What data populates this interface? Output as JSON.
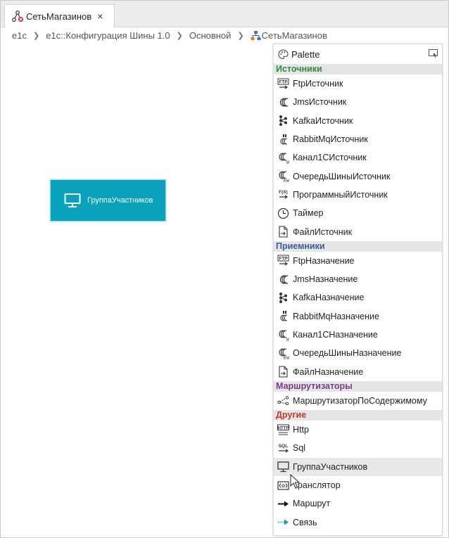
{
  "tab": {
    "label": "СетьМагазинов",
    "close_label": "×"
  },
  "breadcrumb": {
    "items": [
      "e1c",
      "e1c::Конфигурация Шины 1.0",
      "Основной",
      "СетьМагазинов"
    ]
  },
  "canvas": {
    "node": {
      "label": "ГруппаУчастников",
      "color": "#0aa2bd"
    }
  },
  "palette": {
    "title": "Palette",
    "sections": [
      {
        "title": "Источники",
        "color": "#2e8b3a",
        "items": [
          {
            "label": "FtpИсточник",
            "icon": "ftp-icon"
          },
          {
            "label": "JmsИсточник",
            "icon": "jms-icon"
          },
          {
            "label": "KafkaИсточник",
            "icon": "kafka-icon"
          },
          {
            "label": "RabbitMqИсточник",
            "icon": "rabbitmq-icon"
          },
          {
            "label": "Канал1СИсточник",
            "icon": "channel-1c-icon"
          },
          {
            "label": "ОчередьШиныИсточник",
            "icon": "esb-queue-icon"
          },
          {
            "label": "ПрограммныйИсточник",
            "icon": "function-icon"
          },
          {
            "label": "Таймер",
            "icon": "clock-icon"
          },
          {
            "label": "ФайлИсточник",
            "icon": "file-icon"
          }
        ]
      },
      {
        "title": "Приемники",
        "color": "#3c5a99",
        "items": [
          {
            "label": "FtpНазначение",
            "icon": "ftp-icon"
          },
          {
            "label": "JmsНазначение",
            "icon": "jms-icon"
          },
          {
            "label": "KafkaНазначение",
            "icon": "kafka-icon"
          },
          {
            "label": "RabbitMqНазначение",
            "icon": "rabbitmq-icon"
          },
          {
            "label": "Канал1СНазначение",
            "icon": "channel-1c-icon"
          },
          {
            "label": "ОчередьШиныНазначение",
            "icon": "esb-queue-icon"
          },
          {
            "label": "ФайлНазначение",
            "icon": "file-icon"
          }
        ]
      },
      {
        "title": "Маршрутизаторы",
        "color": "#7a3c8a",
        "items": [
          {
            "label": "МаршрутизаторПоСодержимому",
            "icon": "router-icon"
          }
        ]
      },
      {
        "title": "Другие",
        "color": "#c0392b",
        "items": [
          {
            "label": "Http",
            "icon": "http-icon"
          },
          {
            "label": "Sql",
            "icon": "sql-icon"
          },
          {
            "label": "ГруппаУчастников",
            "icon": "monitor-icon"
          },
          {
            "label": "Транслятор",
            "icon": "translator-icon"
          },
          {
            "label": "Маршрут",
            "icon": "route-arrow-icon"
          },
          {
            "label": "Связь",
            "icon": "link-arrow-icon"
          }
        ]
      }
    ]
  }
}
